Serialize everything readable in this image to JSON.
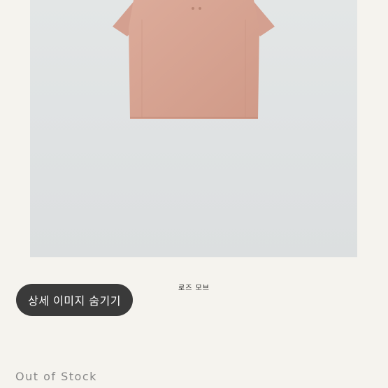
{
  "product": {
    "caption": "로즈 모브",
    "shirt_color": "#d9a493"
  },
  "actions": {
    "hide_details_label": "상세 이미지 숨기기"
  },
  "status": {
    "stock_label": "Out of Stock"
  }
}
